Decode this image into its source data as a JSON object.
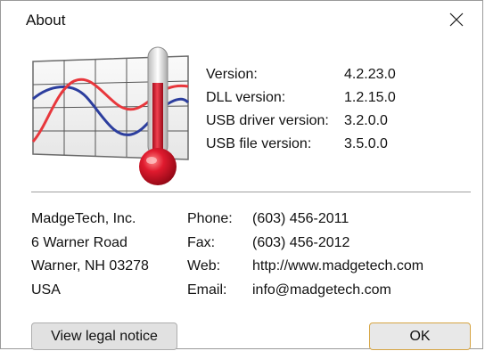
{
  "window": {
    "title": "About"
  },
  "versions": [
    {
      "label": "Version:",
      "value": "4.2.23.0"
    },
    {
      "label": "DLL version:",
      "value": "1.2.15.0"
    },
    {
      "label": "USB driver version:",
      "value": "3.2.0.0"
    },
    {
      "label": "USB file version:",
      "value": "3.5.0.0"
    }
  ],
  "company": {
    "name": "MadgeTech, Inc.",
    "street": "6 Warner Road",
    "city": "Warner, NH 03278",
    "country": "USA"
  },
  "contact": {
    "phone_label": "Phone:",
    "phone": "(603) 456-2011",
    "fax_label": "Fax:",
    "fax": "(603) 456-2012",
    "web_label": "Web:",
    "web": "http://www.madgetech.com",
    "email_label": "Email:",
    "email": "info@madgetech.com"
  },
  "buttons": {
    "legal_label": "View legal notice",
    "ok_label": "OK"
  },
  "colors": {
    "thermo_red": "#d4152b",
    "series_blue": "#2c3e9e",
    "series_red": "#e8373c",
    "ok_border": "#d6a544"
  }
}
